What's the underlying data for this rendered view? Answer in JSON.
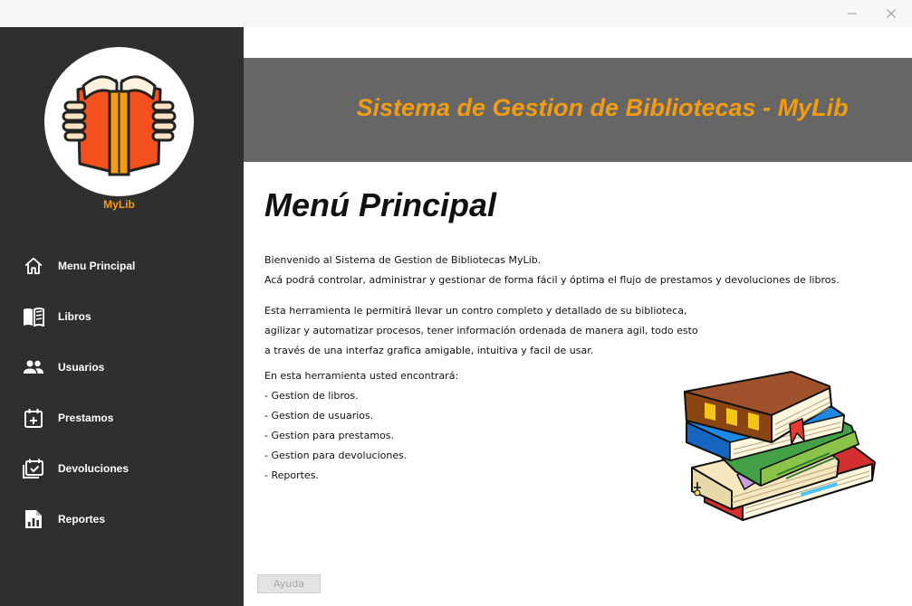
{
  "window": {
    "minimize_icon": "minimize-icon",
    "close_icon": "close-icon"
  },
  "sidebar": {
    "logo_icon": "open-book-icon",
    "app_name": "MyLib",
    "items": [
      {
        "label": "Menu Principal",
        "icon": "home-icon"
      },
      {
        "label": "Libros",
        "icon": "book-icon"
      },
      {
        "label": "Usuarios",
        "icon": "users-icon"
      },
      {
        "label": "Prestamos",
        "icon": "calendar-add-icon"
      },
      {
        "label": "Devoluciones",
        "icon": "calendar-check-icon"
      },
      {
        "label": "Reportes",
        "icon": "report-icon"
      }
    ]
  },
  "header": {
    "title": "Sistema de Gestion de Bibliotecas - MyLib"
  },
  "main": {
    "title": "Menú Principal",
    "intro": [
      "Bienvenido al Sistema de Gestion de Bibliotecas MyLib.",
      "Acá podrá controlar, administrar y gestionar de forma fácil y óptima el flujo de prestamos y devoluciones de libros."
    ],
    "description": [
      "Esta herramienta le permitirá llevar un contro completo y detallado de su biblioteca,",
      "agilizar y automatizar procesos, tener información ordenada de manera agil, todo esto",
      "a través de una interfaz grafica amigable, intuitiva y facil de usar."
    ],
    "features_heading": "En esta herramienta usted encontrará:",
    "features": [
      "- Gestion de libros.",
      "- Gestion de usuarios.",
      "- Gestion para prestamos.",
      "- Gestion para devoluciones.",
      "- Reportes."
    ],
    "illustration": "stack-of-books-icon"
  },
  "footer": {
    "help_label": "Ayuda"
  },
  "colors": {
    "sidebar_bg": "#2f2f2f",
    "header_bg": "#666666",
    "accent": "#f39c12",
    "help_button_bg": "#e3e3e3"
  }
}
